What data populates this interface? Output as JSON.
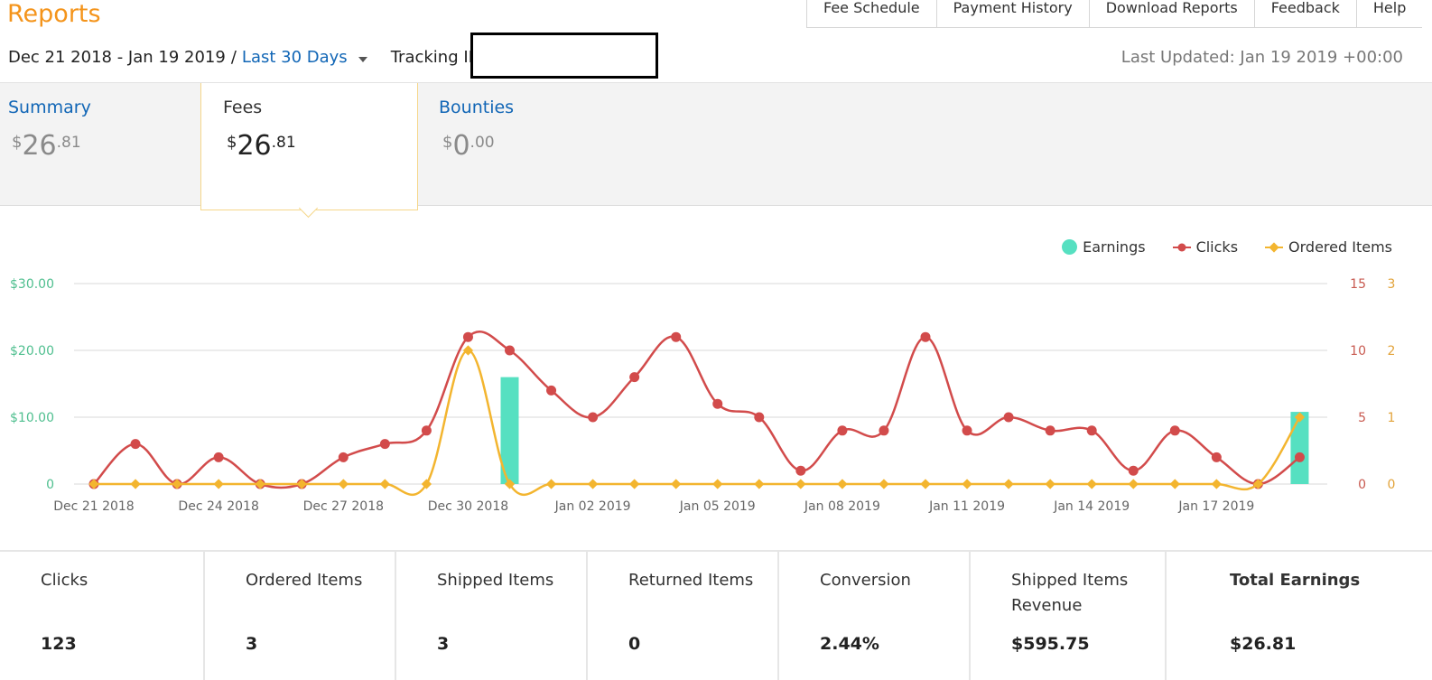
{
  "header": {
    "title": "Reports",
    "nav": [
      "Fee Schedule",
      "Payment History",
      "Download Reports",
      "Feedback",
      "Help"
    ]
  },
  "filters": {
    "date_range": "Dec 21 2018 - Jan 19 2019",
    "separator": "/",
    "range_option": "Last 30 Days",
    "tracking_label": "Tracking ID:"
  },
  "last_updated": "Last Updated: Jan 19 2019 +00:00",
  "tabs": [
    {
      "label": "Summary",
      "currency": "$",
      "whole": "26",
      "cents": ".81"
    },
    {
      "label": "Fees",
      "currency": "$",
      "whole": "26",
      "cents": ".81"
    },
    {
      "label": "Bounties",
      "currency": "$",
      "whole": "0",
      "cents": ".00"
    }
  ],
  "legend": [
    {
      "label": "Earnings",
      "color": "#56e0c1"
    },
    {
      "label": "Clicks",
      "color": "#d24b4b"
    },
    {
      "label": "Ordered Items",
      "color": "#f3b52f"
    }
  ],
  "chart_data": {
    "type": "line",
    "x": [
      "Dec 21 2018",
      "Dec 22 2018",
      "Dec 23 2018",
      "Dec 24 2018",
      "Dec 25 2018",
      "Dec 26 2018",
      "Dec 27 2018",
      "Dec 28 2018",
      "Dec 29 2018",
      "Dec 30 2018",
      "Dec 31 2018",
      "Jan 01 2019",
      "Jan 02 2019",
      "Jan 03 2019",
      "Jan 04 2019",
      "Jan 05 2019",
      "Jan 06 2019",
      "Jan 07 2019",
      "Jan 08 2019",
      "Jan 09 2019",
      "Jan 10 2019",
      "Jan 11 2019",
      "Jan 12 2019",
      "Jan 13 2019",
      "Jan 14 2019",
      "Jan 15 2019",
      "Jan 16 2019",
      "Jan 17 2019",
      "Jan 18 2019",
      "Jan 19 2019"
    ],
    "x_tick_labels": [
      "Dec 21 2018",
      "Dec 24 2018",
      "Dec 27 2018",
      "Dec 30 2018",
      "Jan 02 2019",
      "Jan 05 2019",
      "Jan 08 2019",
      "Jan 11 2019",
      "Jan 14 2019",
      "Jan 17 2019"
    ],
    "series": [
      {
        "name": "Earnings",
        "axis": "left",
        "kind": "bar",
        "color": "#56e0c1",
        "values": [
          0,
          0,
          0,
          0,
          0,
          0,
          0,
          0,
          0,
          0,
          16,
          0,
          0,
          0,
          0,
          0,
          0,
          0,
          0,
          0,
          0,
          0,
          0,
          0,
          0,
          0,
          0,
          0,
          0,
          10.8
        ]
      },
      {
        "name": "Clicks",
        "axis": "right1",
        "kind": "line",
        "color": "#d24b4b",
        "values": [
          0,
          3,
          0,
          2,
          0,
          0,
          2,
          3,
          4,
          11,
          10,
          7,
          5,
          8,
          11,
          6,
          5,
          1,
          4,
          4,
          11,
          4,
          5,
          4,
          4,
          1,
          4,
          2,
          0,
          2
        ]
      },
      {
        "name": "Ordered Items",
        "axis": "right2",
        "kind": "line",
        "color": "#f3b52f",
        "values": [
          0,
          0,
          0,
          0,
          0,
          0,
          0,
          0,
          0,
          2,
          0,
          0,
          0,
          0,
          0,
          0,
          0,
          0,
          0,
          0,
          0,
          0,
          0,
          0,
          0,
          0,
          0,
          0,
          0,
          1
        ]
      }
    ],
    "y_left": {
      "ticks": [
        "0",
        "$10.00",
        "$20.00",
        "$30.00"
      ],
      "range": [
        0,
        30
      ],
      "color": "#4fbf8f"
    },
    "y_right1": {
      "ticks": [
        "0",
        "5",
        "10",
        "15"
      ],
      "range": [
        0,
        15
      ],
      "color": "#c85a50"
    },
    "y_right2": {
      "ticks": [
        "0",
        "1",
        "2",
        "3"
      ],
      "range": [
        0,
        3
      ],
      "color": "#e2a33a"
    },
    "grid": true,
    "legend_position": "top-right"
  },
  "metrics": [
    {
      "label": "Clicks",
      "value": "123"
    },
    {
      "label": "Ordered Items",
      "value": "3"
    },
    {
      "label": "Shipped Items",
      "value": "3"
    },
    {
      "label": "Returned Items",
      "value": "0"
    },
    {
      "label": "Conversion",
      "value": "2.44%"
    },
    {
      "label": "Shipped Items Revenue",
      "value": "$595.75"
    },
    {
      "label": "Total Earnings",
      "value": "$26.81"
    }
  ]
}
